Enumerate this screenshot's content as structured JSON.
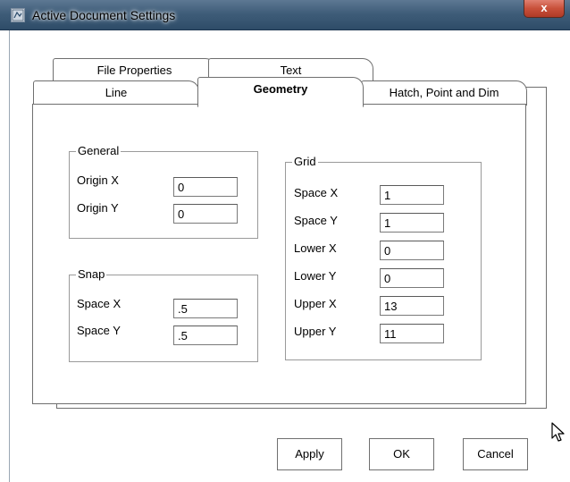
{
  "window": {
    "title": "Active Document Settings",
    "close_label": "x"
  },
  "tabs": {
    "row_back": [
      "File Properties",
      "Text"
    ],
    "row_front": [
      "Line",
      "Geometry",
      "Hatch, Point and Dim"
    ],
    "active": "Geometry"
  },
  "general": {
    "label": "General",
    "origin_x_label": "Origin X",
    "origin_x_value": "0",
    "origin_y_label": "Origin Y",
    "origin_y_value": "0"
  },
  "snap": {
    "label": "Snap",
    "space_x_label": "Space X",
    "space_x_value": ".5",
    "space_y_label": "Space Y",
    "space_y_value": ".5"
  },
  "grid": {
    "label": "Grid",
    "space_x_label": "Space X",
    "space_x_value": "1",
    "space_y_label": "Space Y",
    "space_y_value": "1",
    "lower_x_label": "Lower X",
    "lower_x_value": "0",
    "lower_y_label": "Lower Y",
    "lower_y_value": "0",
    "upper_x_label": "Upper X",
    "upper_x_value": "13",
    "upper_y_label": "Upper Y",
    "upper_y_value": "11"
  },
  "buttons": {
    "apply": "Apply",
    "ok": "OK",
    "cancel": "Cancel"
  },
  "icons": {
    "app": "app-icon",
    "close": "close-icon",
    "cursor": "mouse-cursor-icon"
  }
}
